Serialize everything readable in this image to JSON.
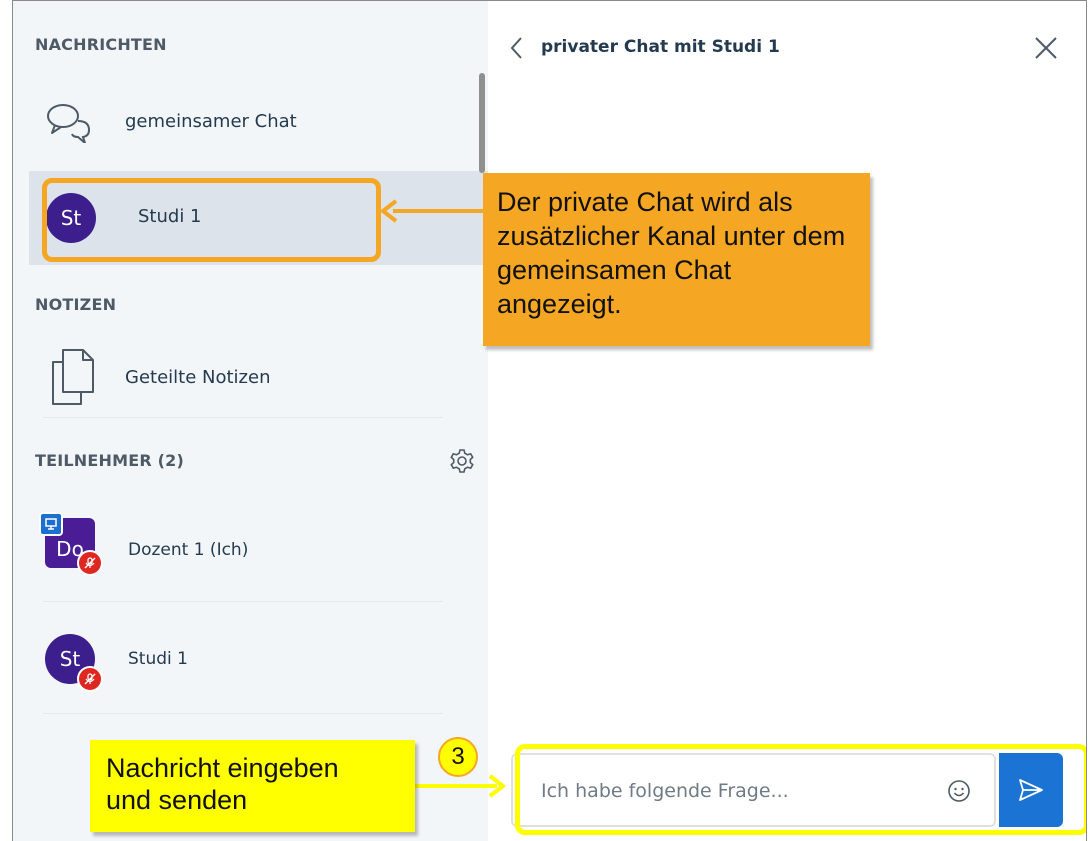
{
  "sidebar": {
    "messages_title": "NACHRICHTEN",
    "public_chat_label": "gemeinsamer Chat",
    "private_chat": {
      "avatar": "St",
      "label": "Studi 1"
    },
    "notes_title": "NOTIZEN",
    "shared_notes_label": "Geteilte Notizen",
    "participants_title": "TEILNEHMER (2)",
    "participants": [
      {
        "avatar": "Do",
        "name": "Dozent 1 (Ich)",
        "presenter": true,
        "muted": true
      },
      {
        "avatar": "St",
        "name": "Studi 1",
        "presenter": false,
        "muted": true
      }
    ]
  },
  "chat": {
    "title": "privater Chat mit Studi 1",
    "input_value": "",
    "input_placeholder": "Ich habe folgende Frage..."
  },
  "annotations": {
    "callout_text": "Der private Chat wird als zusätzlicher Kanal unter dem gemeinsamen Chat angezeigt.",
    "step_number": "3",
    "step_line1": "Nachricht eingeben",
    "step_line2": "und senden"
  },
  "colors": {
    "avatar_purple": "#3c1e8c",
    "send_blue": "#1b74d4",
    "annotation_orange": "#f5a623",
    "annotation_yellow": "#ffff00",
    "mute_red": "#df2721"
  }
}
